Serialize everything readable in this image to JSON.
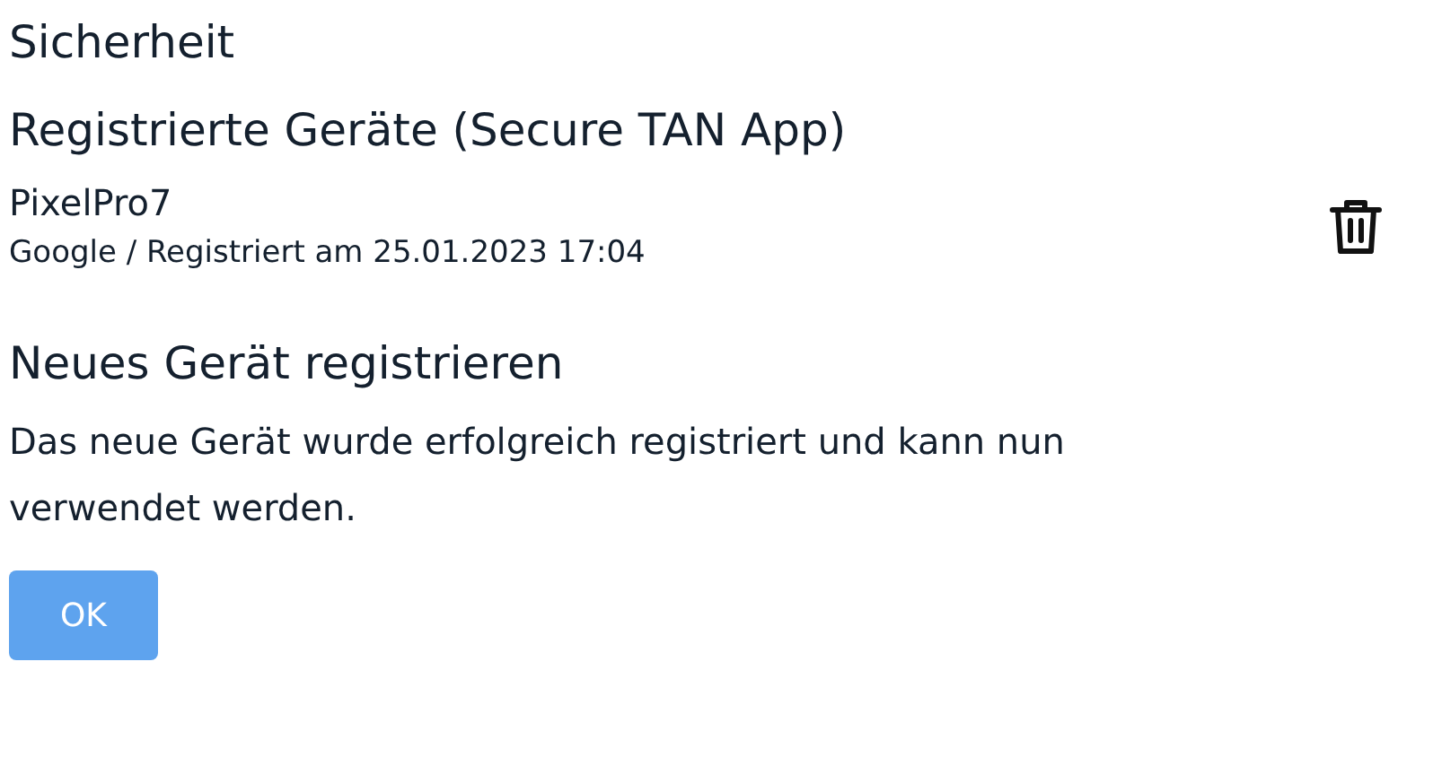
{
  "page_title": "Sicherheit",
  "devices_section": {
    "heading": "Registrierte Geräte (Secure TAN App)",
    "devices": [
      {
        "name": "PixelPro7",
        "details": "Google / Registriert am 25.01.2023 17:04"
      }
    ]
  },
  "new_device_section": {
    "heading": "Neues Gerät registrieren",
    "message": "Das neue Gerät wurde erfolgreich registriert und kann nun verwendet werden.",
    "button": "OK"
  }
}
